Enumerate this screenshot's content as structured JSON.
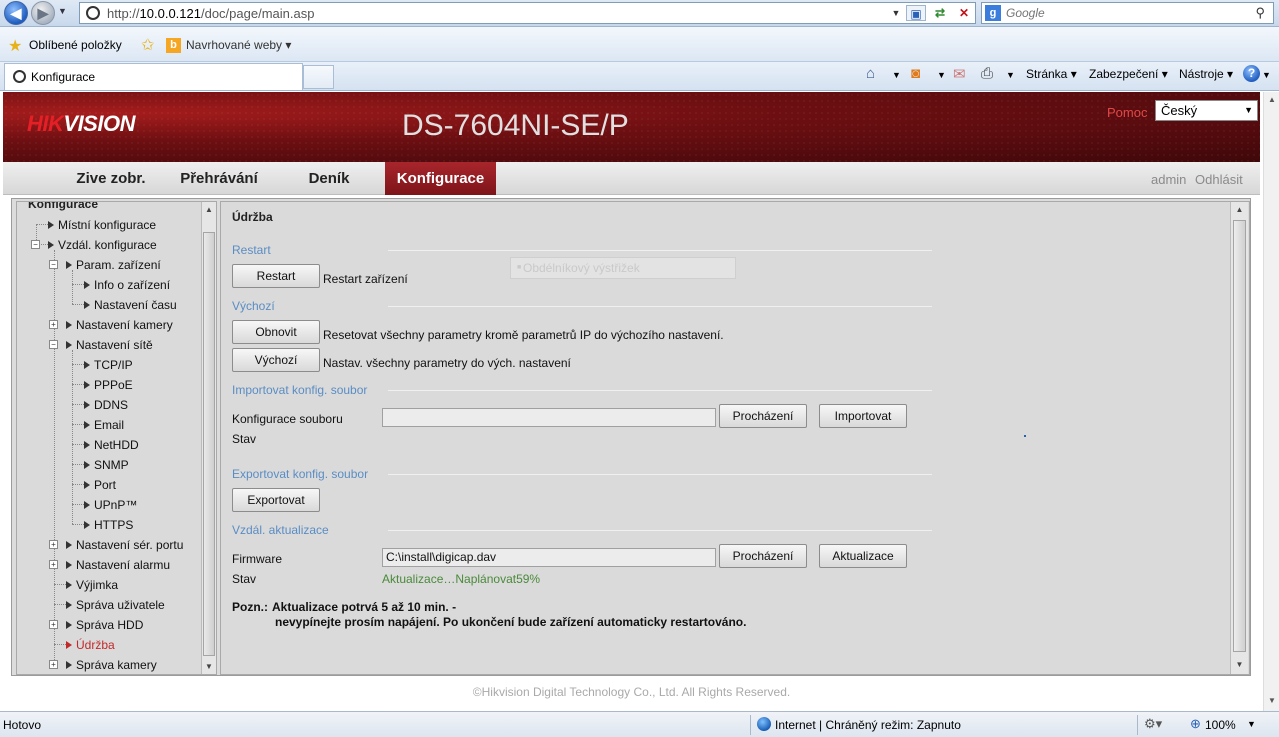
{
  "browser": {
    "url_prefix": "http://",
    "url_host": "10.0.0.121",
    "url_path": "/doc/page/main.asp",
    "search_placeholder": "Google",
    "favorites_label": "Oblíbené položky",
    "suggested_sites": "Navrhované weby",
    "tab_title": "Konfigurace",
    "commands": {
      "page": "Stránka",
      "security": "Zabezpečení",
      "tools": "Nástroje"
    },
    "status": "Hotovo",
    "zone": "Internet | Chráněný režim: Zapnuto",
    "zoom": "100%"
  },
  "header": {
    "logo_part1": "HIK",
    "logo_part2": "VISION",
    "model": "DS-7604NI-SE/P",
    "help": "Pomoc",
    "language": "Český"
  },
  "nav": {
    "tabs": [
      {
        "label": "Zive zobr."
      },
      {
        "label": "Přehrávání"
      },
      {
        "label": "Deník"
      },
      {
        "label": "Konfigurace",
        "active": true
      }
    ],
    "user": "admin",
    "logout": "Odhlásit"
  },
  "tree": {
    "title": "Konfigurace",
    "items": [
      {
        "label": "Místní konfigurace"
      },
      {
        "label": "Vzdál. konfigurace"
      },
      {
        "label": "Param. zařízení"
      },
      {
        "label": "Info o zařízení"
      },
      {
        "label": "Nastavení času"
      },
      {
        "label": "Nastavení kamery"
      },
      {
        "label": "Nastavení sítě"
      },
      {
        "label": "TCP/IP"
      },
      {
        "label": "PPPoE"
      },
      {
        "label": "DDNS"
      },
      {
        "label": "Email"
      },
      {
        "label": "NetHDD"
      },
      {
        "label": "SNMP"
      },
      {
        "label": "Port"
      },
      {
        "label": "UPnP™"
      },
      {
        "label": "HTTPS"
      },
      {
        "label": "Nastavení sér. portu"
      },
      {
        "label": "Nastavení alarmu"
      },
      {
        "label": "Výjimka"
      },
      {
        "label": "Správa uživatele"
      },
      {
        "label": "Správa HDD"
      },
      {
        "label": "Údržba",
        "active": true
      },
      {
        "label": "Správa kamery"
      }
    ]
  },
  "panel": {
    "title": "Údržba",
    "tooltip": "Obdélníkový výstřižek",
    "restart": {
      "section": "Restart",
      "button": "Restart",
      "desc": "Restart zařízení"
    },
    "default": {
      "section": "Výchozí",
      "restore_button": "Obnovit",
      "restore_desc": "Resetovat všechny parametry kromě parametrů IP do výchozího nastavení.",
      "default_button": "Výchozí",
      "default_desc": "Nastav. všechny parametry do vých. nastavení"
    },
    "import": {
      "section": "Importovat konfig. soubor",
      "file_label": "Konfigurace souboru",
      "file_value": "",
      "browse": "Procházení",
      "import_button": "Importovat",
      "status_label": "Stav"
    },
    "export": {
      "section": "Exportovat konfig. soubor",
      "button": "Exportovat"
    },
    "upgrade": {
      "section": "Vzdál. aktualizace",
      "firmware_label": "Firmware",
      "firmware_value": "C:\\install\\digicap.dav",
      "browse": "Procházení",
      "upgrade_button": "Aktualizace",
      "status_label": "Stav",
      "status_value": "Aktualizace…Naplánovat59%"
    },
    "note_label": "Pozn.:",
    "note_line1": "Aktualizace potrvá 5 až 10 min. -",
    "note_line2": "nevypínejte prosím napájení. Po ukončení bude zařízení automaticky restartováno."
  },
  "footer": {
    "copyright": "©Hikvision Digital Technology Co., Ltd. All Rights Reserved."
  },
  "colors": {
    "brand_red": "#7d1419",
    "section_blue": "#5a8dc4",
    "active_tree": "#c22a2a",
    "progress_green": "#4a8a3a"
  }
}
